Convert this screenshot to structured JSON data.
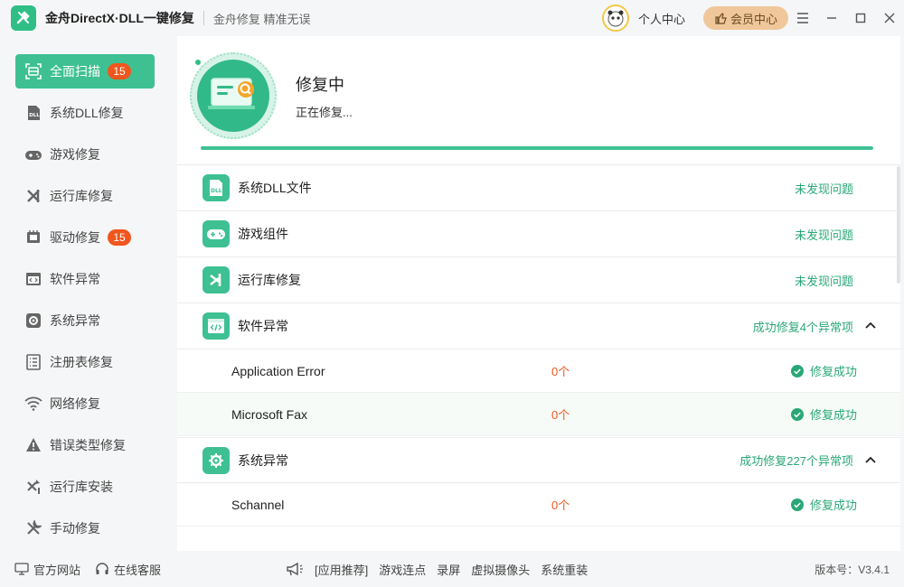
{
  "titlebar": {
    "app_title": "金舟DirectX·DLL一键修复",
    "slogan": "金舟修复 精准无误",
    "personal_center": "个人中心",
    "vip_center": "会员中心"
  },
  "sidebar": {
    "items": [
      {
        "label": "全面扫描",
        "badge": "15",
        "icon": "scan-icon"
      },
      {
        "label": "系统DLL修复",
        "icon": "dll-icon"
      },
      {
        "label": "游戏修复",
        "icon": "gamepad-icon"
      },
      {
        "label": "运行库修复",
        "icon": "runtime-icon"
      },
      {
        "label": "驱动修复",
        "badge": "15",
        "icon": "driver-icon"
      },
      {
        "label": "软件异常",
        "icon": "code-window-icon"
      },
      {
        "label": "系统异常",
        "icon": "gear-icon"
      },
      {
        "label": "注册表修复",
        "icon": "list-icon"
      },
      {
        "label": "网络修复",
        "icon": "wifi-icon"
      },
      {
        "label": "错误类型修复",
        "icon": "warning-icon"
      },
      {
        "label": "运行库安装",
        "icon": "install-icon"
      },
      {
        "label": "手动修复",
        "icon": "wrench-icon"
      }
    ]
  },
  "hero": {
    "title": "修复中",
    "subtitle": "正在修复...",
    "progress": 1.0
  },
  "categories": [
    {
      "label": "系统DLL文件",
      "status": "未发现问题",
      "icon": "dll-icon"
    },
    {
      "label": "游戏组件",
      "status": "未发现问题",
      "icon": "gamepad-icon"
    },
    {
      "label": "运行库修复",
      "status": "未发现问题",
      "icon": "runtime-icon"
    },
    {
      "label": "软件异常",
      "status": "成功修复4个异常项",
      "icon": "code-window-icon"
    },
    {
      "label": "系统异常",
      "status": "成功修复227个异常项",
      "icon": "gear-icon"
    }
  ],
  "software_items": [
    {
      "name": "Application Error",
      "count": "0个",
      "status": "修复成功"
    },
    {
      "name": "Microsoft Fax",
      "count": "0个",
      "status": "修复成功"
    }
  ],
  "system_items": [
    {
      "name": "Schannel",
      "count": "0个",
      "status": "修复成功"
    }
  ],
  "footer": {
    "official_site": "官方网站",
    "online_service": "在线客服",
    "app_recommend": "[应用推荐]",
    "links": [
      "游戏连点",
      "录屏",
      "虚拟摄像头",
      "系统重装"
    ],
    "version": "版本号：V3.4.1"
  },
  "colors": {
    "accent": "#3ec092",
    "badge": "#f0561d",
    "success": "#2aa777"
  }
}
